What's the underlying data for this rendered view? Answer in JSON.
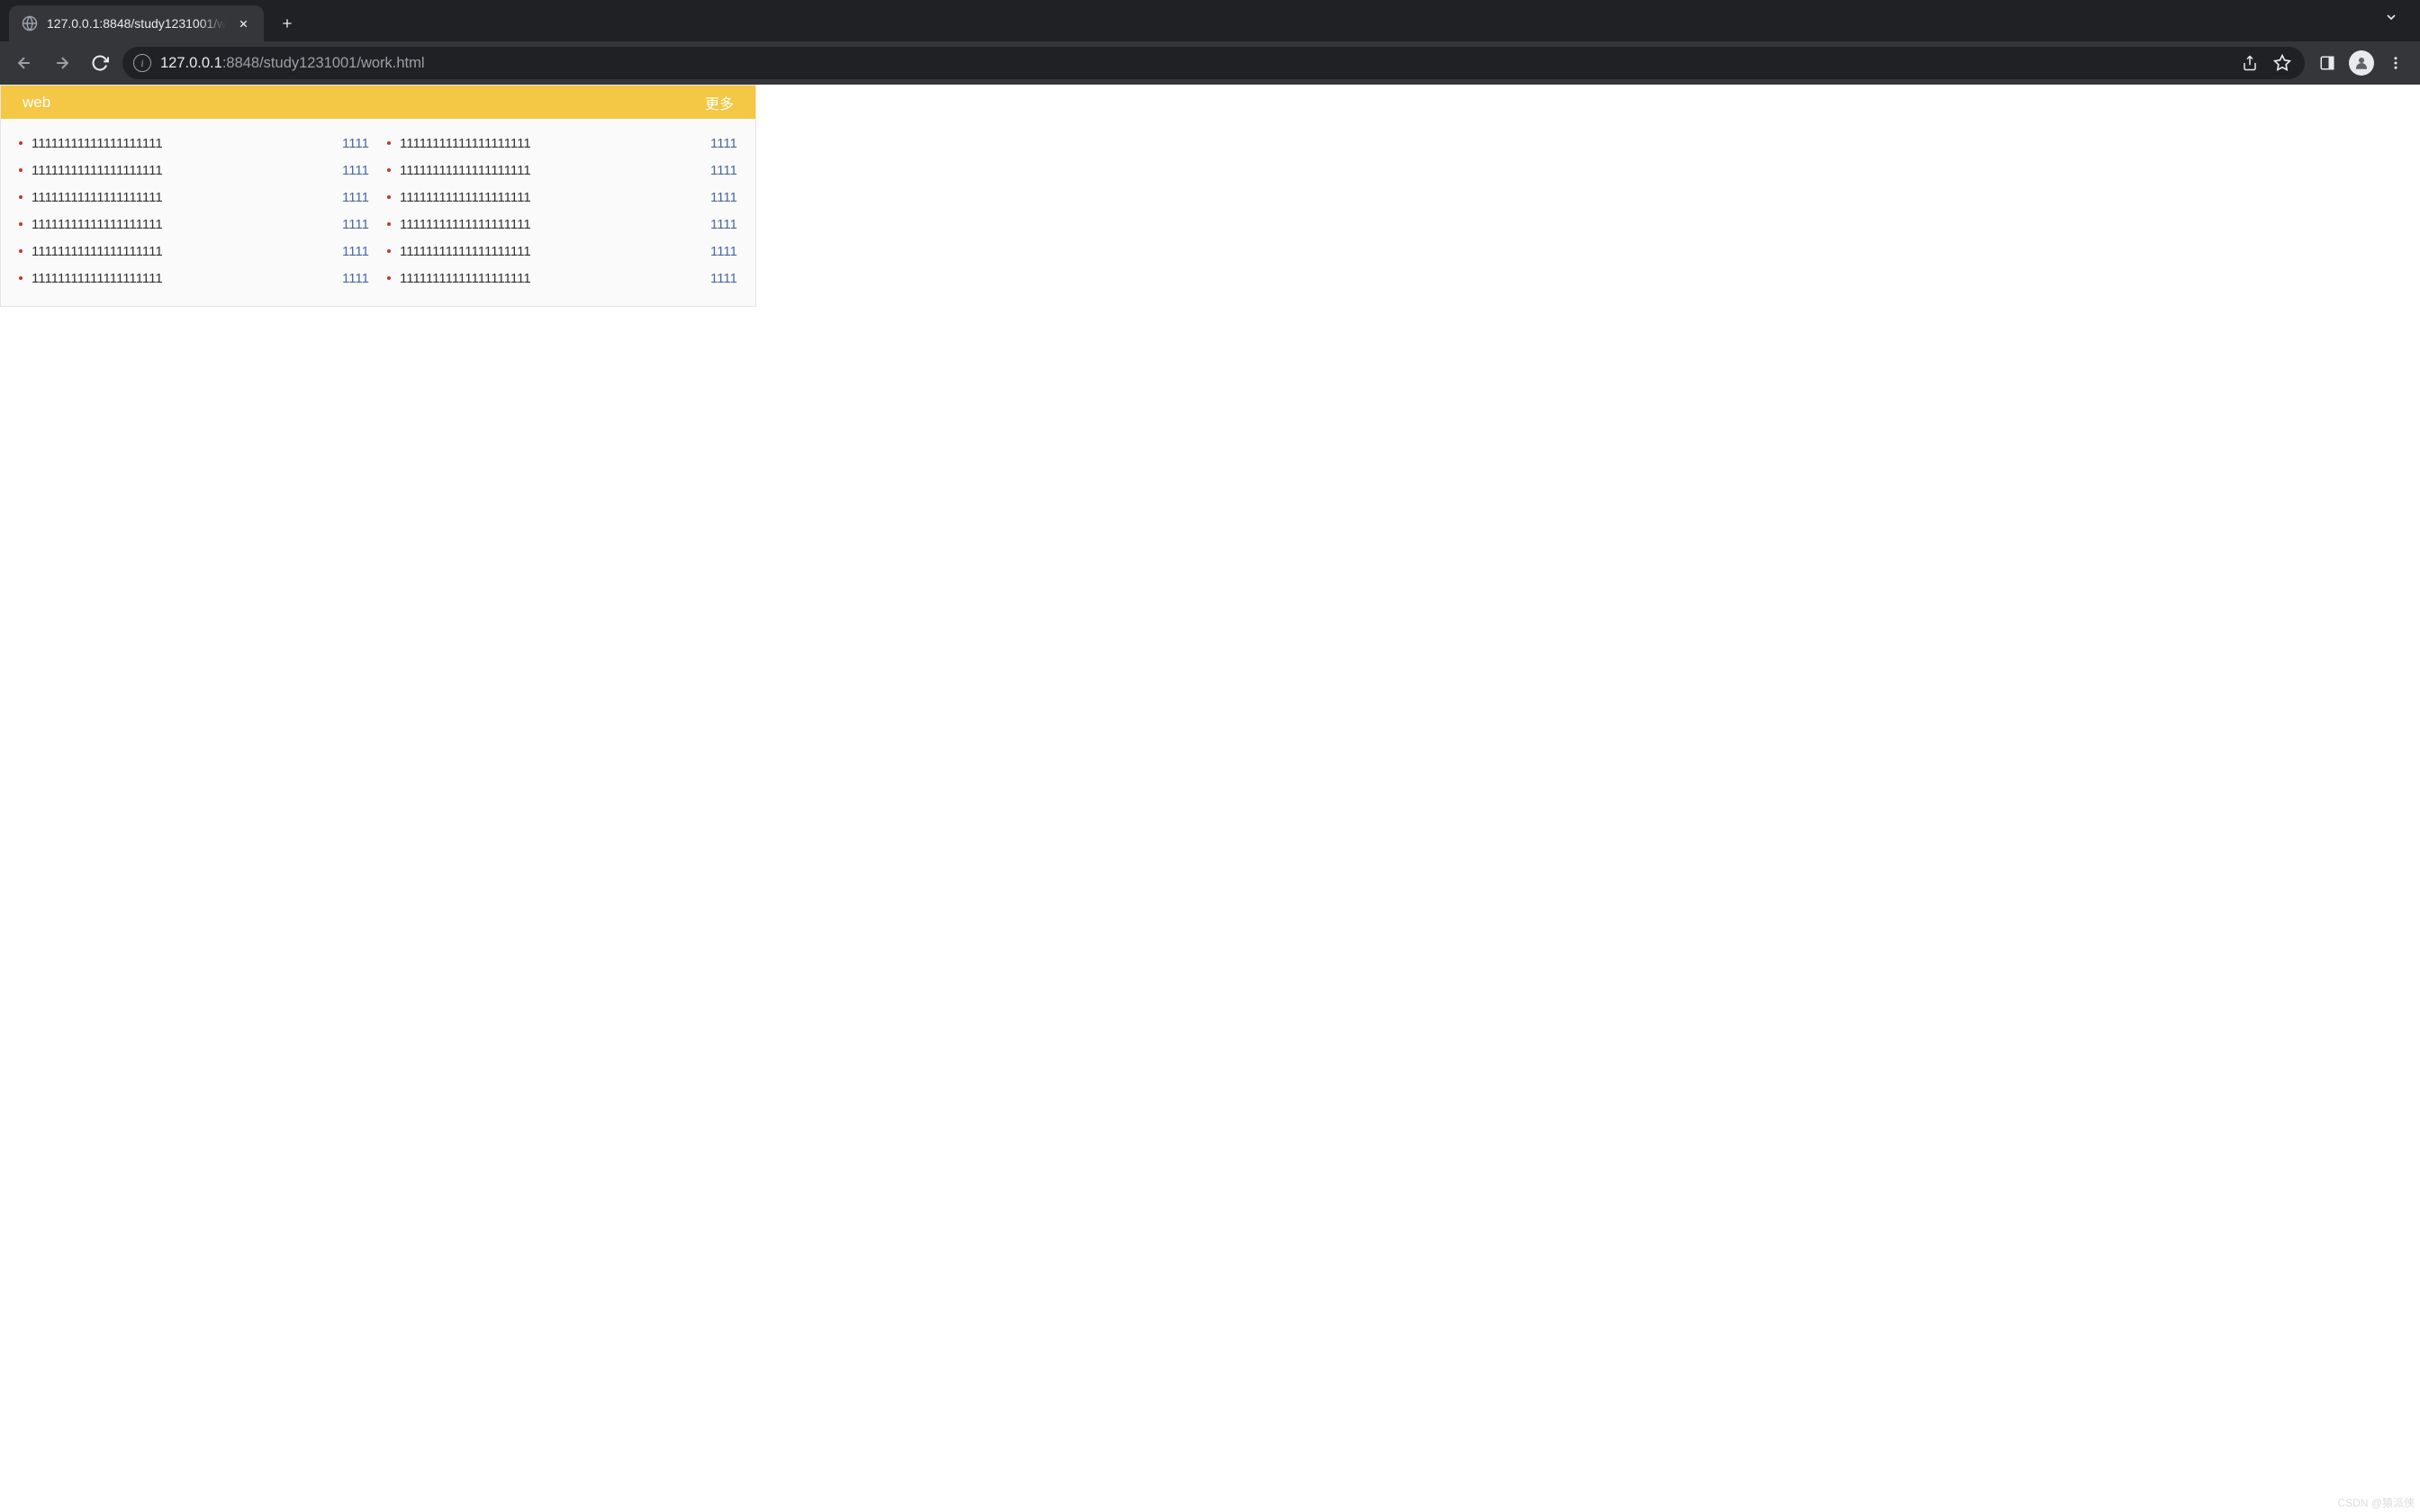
{
  "browser": {
    "tab": {
      "title": "127.0.0.1:8848/study1231001/w"
    },
    "url": {
      "host": "127.0.0.1",
      "dim": ":8848/study1231001/work.html"
    }
  },
  "panel": {
    "title": "web",
    "more": "更多",
    "columns": [
      [
        {
          "text": "11111111111111111111",
          "link": "1111"
        },
        {
          "text": "11111111111111111111",
          "link": "1111"
        },
        {
          "text": "11111111111111111111",
          "link": "1111"
        },
        {
          "text": "11111111111111111111",
          "link": "1111"
        },
        {
          "text": "11111111111111111111",
          "link": "1111"
        },
        {
          "text": "11111111111111111111",
          "link": "1111"
        }
      ],
      [
        {
          "text": "11111111111111111111",
          "link": "1111"
        },
        {
          "text": "11111111111111111111",
          "link": "1111"
        },
        {
          "text": "11111111111111111111",
          "link": "1111"
        },
        {
          "text": "11111111111111111111",
          "link": "1111"
        },
        {
          "text": "11111111111111111111",
          "link": "1111"
        },
        {
          "text": "11111111111111111111",
          "link": "1111"
        }
      ]
    ]
  },
  "watermark": "CSDN @猿派侠"
}
